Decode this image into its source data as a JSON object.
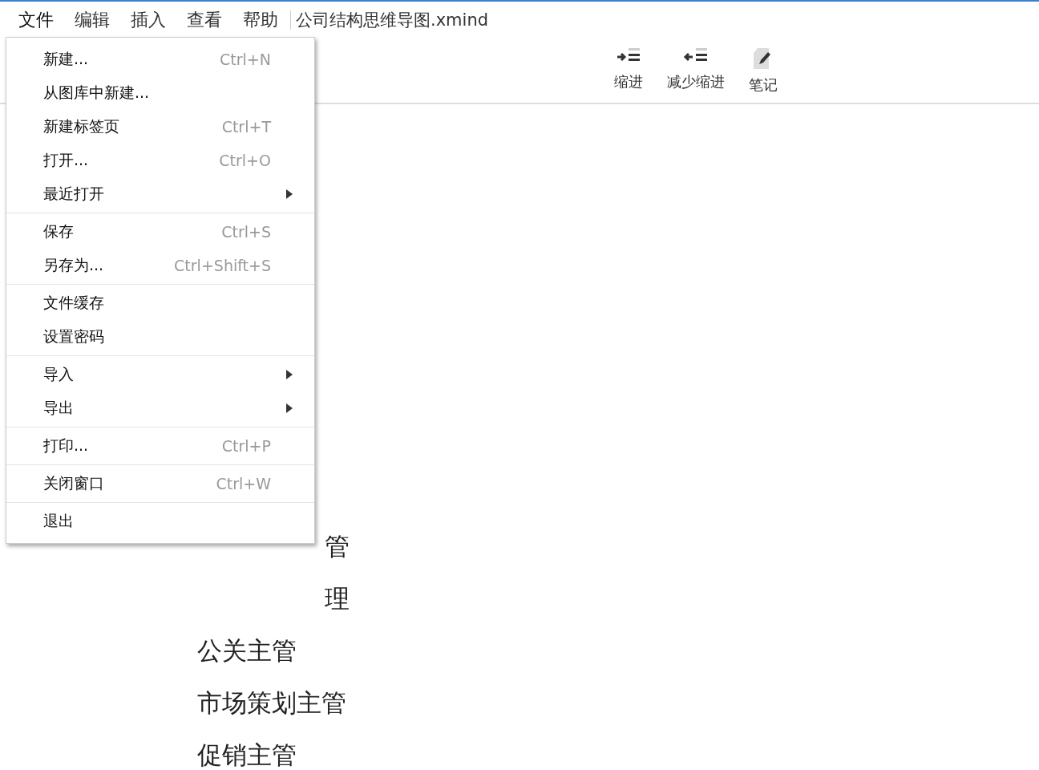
{
  "menubar": {
    "items": [
      {
        "label": "文件",
        "selected": true
      },
      {
        "label": "编辑",
        "selected": false
      },
      {
        "label": "插入",
        "selected": false
      },
      {
        "label": "查看",
        "selected": false
      },
      {
        "label": "帮助",
        "selected": false
      }
    ],
    "document_title": "公司结构思维导图.xmind"
  },
  "toolbar": {
    "buttons": [
      {
        "kind": "indent",
        "label": "缩进"
      },
      {
        "kind": "outdent",
        "label": "减少缩进"
      },
      {
        "kind": "note",
        "label": "笔记"
      }
    ]
  },
  "file_menu": {
    "groups": [
      [
        {
          "label": "新建...",
          "shortcut": "Ctrl+N",
          "submenu": false
        },
        {
          "label": "从图库中新建...",
          "submenu": false
        },
        {
          "label": "新建标签页",
          "shortcut": "Ctrl+T",
          "submenu": false
        },
        {
          "label": "打开...",
          "shortcut": "Ctrl+O",
          "submenu": false
        },
        {
          "label": "最近打开",
          "submenu": true
        }
      ],
      [
        {
          "label": "保存",
          "shortcut": "Ctrl+S",
          "submenu": false
        },
        {
          "label": "另存为...",
          "shortcut": "Ctrl+Shift+S",
          "submenu": false
        }
      ],
      [
        {
          "label": "文件缓存",
          "submenu": false
        },
        {
          "label": "设置密码",
          "submenu": false
        }
      ],
      [
        {
          "label": "导入",
          "submenu": true
        },
        {
          "label": "导出",
          "submenu": true
        }
      ],
      [
        {
          "label": "打印...",
          "shortcut": "Ctrl+P",
          "submenu": false
        }
      ],
      [
        {
          "label": "关闭窗口",
          "shortcut": "Ctrl+W",
          "submenu": false
        }
      ],
      [
        {
          "label": "退出",
          "submenu": false
        }
      ]
    ]
  },
  "outline": {
    "items": [
      {
        "text": "管",
        "clipped": true
      },
      {
        "text": "理",
        "clipped": true
      },
      {
        "text": "公关主管",
        "clipped": false
      },
      {
        "text": "市场策划主管",
        "clipped": false
      },
      {
        "text": "促销主管",
        "clipped": false
      }
    ]
  }
}
